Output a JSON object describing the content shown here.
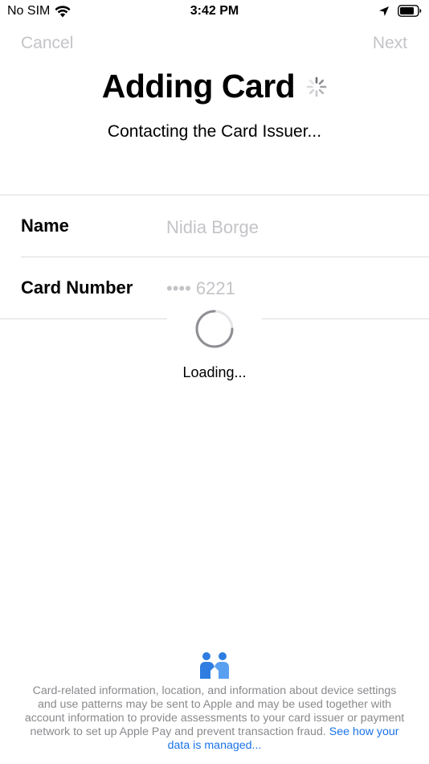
{
  "status_bar": {
    "carrier": "No SIM",
    "time": "3:42 PM"
  },
  "nav": {
    "cancel_label": "Cancel",
    "next_label": "Next"
  },
  "header": {
    "title": "Adding Card",
    "subtitle": "Contacting the Card Issuer..."
  },
  "form": {
    "name_label": "Name",
    "name_value": "Nidia Borge",
    "card_number_label": "Card Number",
    "card_number_value": "•••• 6221"
  },
  "loading": {
    "text": "Loading..."
  },
  "footer": {
    "privacy_text": "Card-related information, location, and information about device settings and use patterns may be sent to Apple and may be used together with account information to provide assessments to your card issuer or payment network to set up Apple Pay and prevent transaction fraud.",
    "privacy_link": "See how your data is managed..."
  },
  "colors": {
    "placeholder": "#c4c4c8",
    "link": "#1a73e8",
    "privacy_icon": "#2f7de1"
  },
  "icons": [
    "wifi-icon",
    "location-icon",
    "battery-icon",
    "activity-spinner-icon",
    "privacy-handshake-icon"
  ]
}
